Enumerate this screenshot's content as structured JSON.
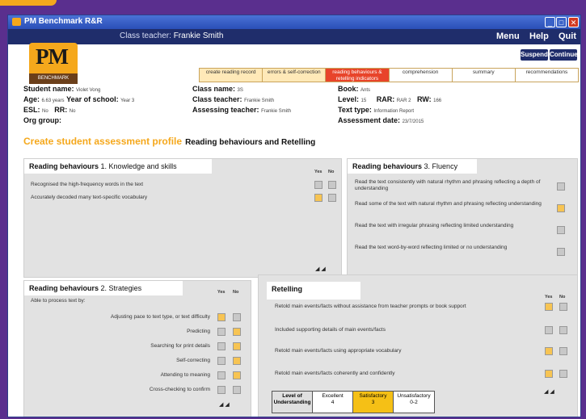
{
  "window": {
    "title": "PM Benchmark R&R"
  },
  "bar": {
    "teacher_label": "Class teacher:",
    "teacher_name": "Frankie Smith"
  },
  "menu": {
    "menu": "Menu",
    "help": "Help",
    "quit": "Quit"
  },
  "actions": {
    "suspend": "Suspend",
    "continue": "Continue"
  },
  "logo": {
    "text": "PM",
    "sub": "BENCHMARK"
  },
  "steps": [
    {
      "label": "create reading record",
      "state": "done"
    },
    {
      "label": "errors & self-correction",
      "state": "done"
    },
    {
      "label": "reading behaviours & retelling indicators",
      "state": "active"
    },
    {
      "label": "comprehension",
      "state": "todo"
    },
    {
      "label": "summary",
      "state": "todo"
    },
    {
      "label": "recommendations",
      "state": "todo"
    }
  ],
  "student": {
    "name_label": "Student name:",
    "name": "Violet Vong",
    "age_label": "Age:",
    "age": "6.63 years",
    "year_label": "Year of school:",
    "year": "Year 3",
    "esl_label": "ESL:",
    "esl": "No",
    "rr_label": "RR:",
    "rr": "No",
    "org_label": "Org group:",
    "org": ""
  },
  "class": {
    "name_label": "Class name:",
    "name": "3S",
    "teacher_label": "Class teacher:",
    "teacher": "Frankie Smith",
    "assessing_label": "Assessing teacher:",
    "assessing": "Frankie Smith"
  },
  "book": {
    "book_label": "Book:",
    "book": "Ants",
    "level_label": "Level:",
    "level": "15",
    "rar_label": "RAR:",
    "rar": "RAR 2",
    "rw_label": "RW:",
    "rw": "166",
    "type_label": "Text type:",
    "type": "Information Report",
    "date_label": "Assessment date:",
    "date": "23/7/2015"
  },
  "heading": {
    "main": "Create student assessment profile",
    "sub": "Reading behaviours and Retelling"
  },
  "yes_label": "Yes",
  "no_label": "No",
  "p1": {
    "title": "Reading behaviours",
    "subtitle": "1. Knowledge and skills",
    "items": [
      {
        "text": "Recognised the high-frequency words in the text",
        "yes": false,
        "no": false
      },
      {
        "text": "Accurately decoded many text-specific vocabulary",
        "yes": true,
        "no": false
      }
    ]
  },
  "p2": {
    "title": "Reading behaviours",
    "subtitle": "2. Strategies",
    "intro": "Able to process text by:",
    "items": [
      {
        "text": "Adjusting pace to text type, or text difficulty",
        "yes": true,
        "no": false
      },
      {
        "text": "Predicting",
        "yes": false,
        "no": true
      },
      {
        "text": "Searching for print details",
        "yes": false,
        "no": true
      },
      {
        "text": "Self-correcting",
        "yes": false,
        "no": true
      },
      {
        "text": "Attending to meaning",
        "yes": false,
        "no": true
      },
      {
        "text": "Cross-checking to confirm",
        "yes": false,
        "no": false
      }
    ]
  },
  "p3": {
    "title": "Reading behaviours",
    "subtitle": "3. Fluency",
    "items": [
      {
        "text": "Read the text consistently with natural rhythm and phrasing reflecting a depth of understanding",
        "sel": false
      },
      {
        "text": "Read some of the text with natural rhythm and phrasing reflecting understanding",
        "sel": true
      },
      {
        "text": "Read the text with irregular phrasing reflecting limited understanding",
        "sel": false
      },
      {
        "text": "Read the text word-by-word reflecting limited or no understanding",
        "sel": false
      }
    ]
  },
  "p4": {
    "title": "Retelling",
    "items": [
      {
        "text": "Retold main events/facts without assistance from teacher prompts or book support",
        "yes": true,
        "no": false
      },
      {
        "text": "Included supporting details of main events/facts",
        "yes": false,
        "no": true
      },
      {
        "text": "Retold main events/facts using appropriate vocabulary",
        "yes": true,
        "no": false
      },
      {
        "text": "Retold main events/facts coherently and confidently",
        "yes": true,
        "no": false
      }
    ]
  },
  "scale": [
    {
      "label": "Level of Understanding",
      "num": ""
    },
    {
      "label": "Excellent",
      "num": "4"
    },
    {
      "label": "Satisfactory",
      "num": "3"
    },
    {
      "label": "Unsatisfactory",
      "num": "0-2"
    }
  ],
  "colors": {
    "accent": "#f5a81c",
    "navy": "#1f2d6b",
    "active_step": "#e8442a",
    "yes_box": "#f7c453",
    "no_box": "#c8c8c8"
  }
}
